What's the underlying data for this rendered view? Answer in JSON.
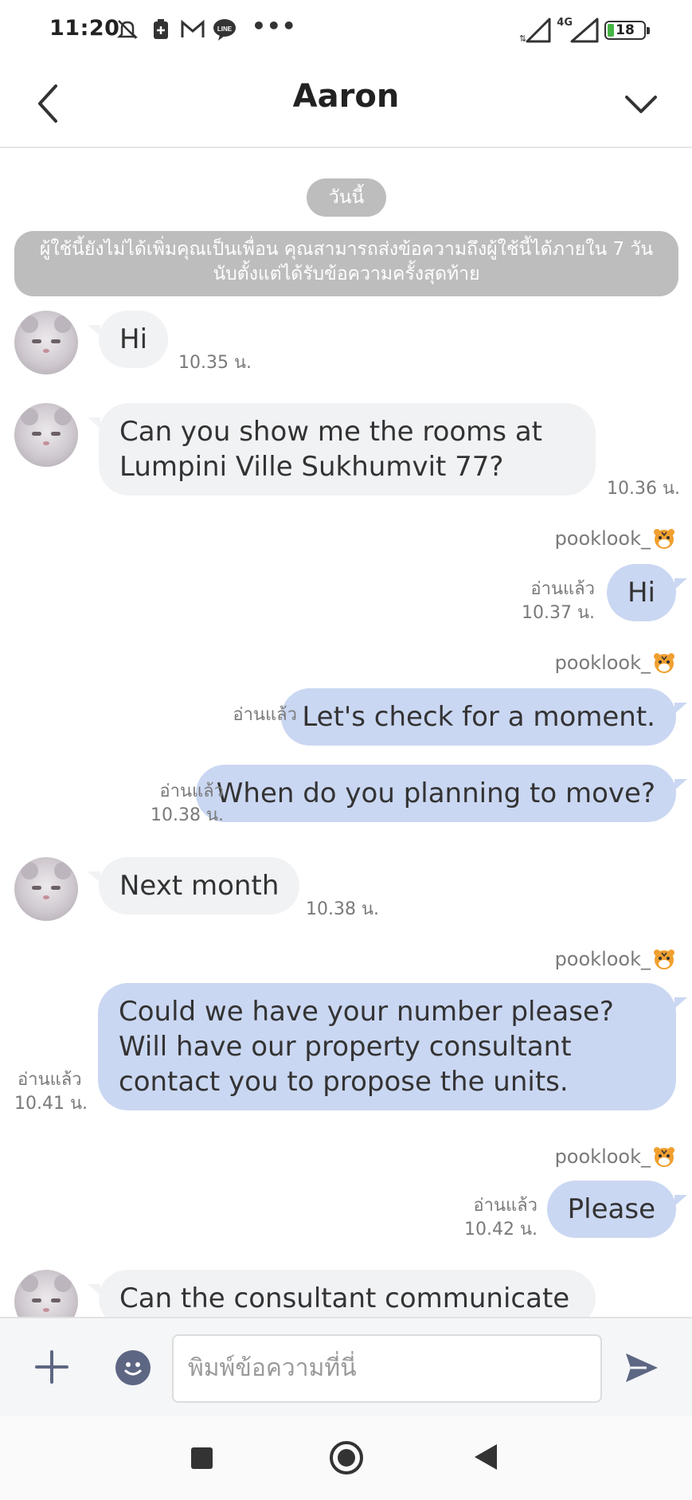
{
  "status_bar": {
    "time": "11:20",
    "network": "4G",
    "battery": "18",
    "battery_fraction": 0.18,
    "more": "•••"
  },
  "header": {
    "title": "Aaron"
  },
  "chat": {
    "date_label": "วันนี้",
    "notice": "ผู้ใช้นี้ยังไม่ได้เพิ่มคุณเป็นเพื่อน คุณสามารถส่งข้อความถึงผู้ใช้นี้ได้ภายใน 7 วันนับตั้งแต่ได้รับข้อความครั้งสุดท้าย",
    "messages": [
      {
        "dir": "in",
        "text": "Hi",
        "time": "10.35 น."
      },
      {
        "dir": "in",
        "text": "Can you show me the rooms at Lumpini Ville Sukhumvit 77?",
        "time": "10.36 น."
      },
      {
        "dir": "out",
        "sender": "pooklook_",
        "text": "Hi",
        "read": "อ่านแล้ว",
        "time": "10.37 น."
      },
      {
        "dir": "out",
        "sender": "pooklook_",
        "text": "Let's check for a moment.",
        "read": "อ่านแล้ว",
        "time": ""
      },
      {
        "dir": "out",
        "text": "When do you planning to move?",
        "read": "อ่านแล้ว",
        "time": "10.38 น."
      },
      {
        "dir": "in",
        "text": "Next month",
        "time": "10.38 น."
      },
      {
        "dir": "out",
        "sender": "pooklook_",
        "text": "Could we have your number please? Will have our property consultant contact you to propose the units.",
        "read": "อ่านแล้ว",
        "time": "10.41 น."
      },
      {
        "dir": "out",
        "sender": "pooklook_",
        "text": "Please",
        "read": "อ่านแล้ว",
        "time": "10.42 น."
      },
      {
        "dir": "in",
        "text": "Can the consultant communicate",
        "time": ""
      }
    ]
  },
  "input": {
    "placeholder": "พิมพ์ข้อความที่นี่"
  },
  "colors": {
    "incoming_bubble": "#f1f2f4",
    "outgoing_bubble": "#cad7f2",
    "system_pill": "#bdbdbd"
  }
}
